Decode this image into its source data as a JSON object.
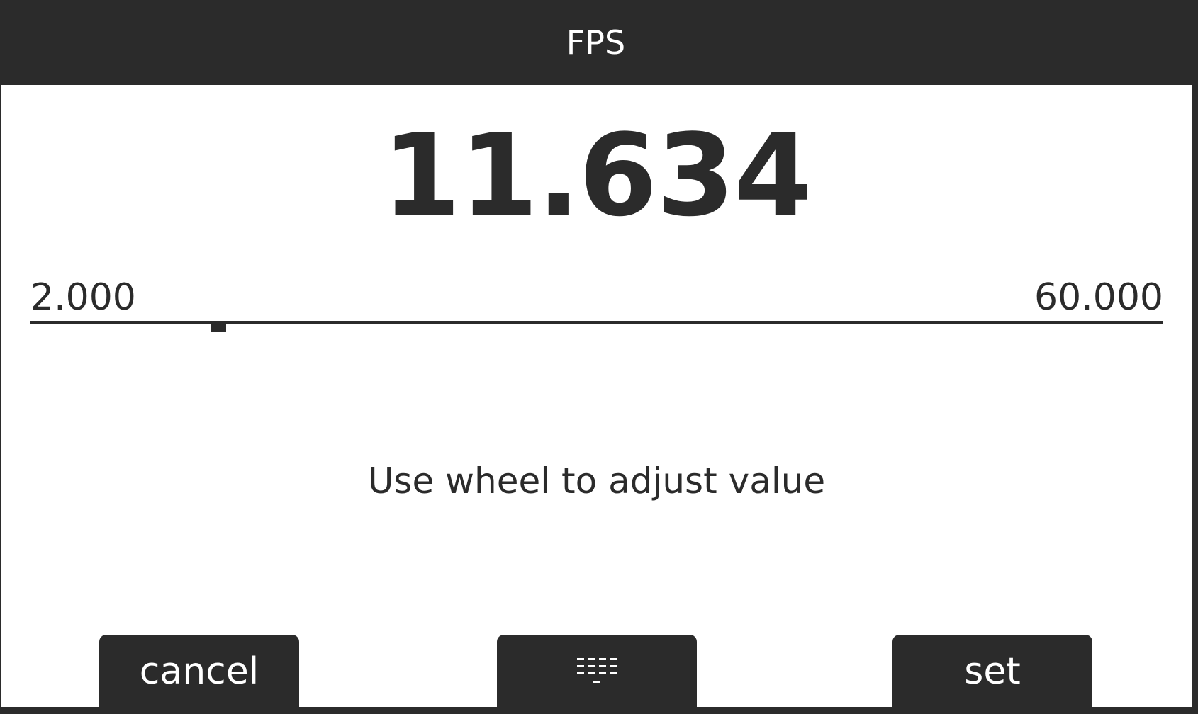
{
  "header": {
    "title": "FPS"
  },
  "value": {
    "current": "11.634",
    "min_label": "2.000",
    "max_label": "60.000",
    "slider_fraction": 0.166
  },
  "hint": "Use wheel to adjust value",
  "buttons": {
    "cancel_label": "cancel",
    "keypad_icon": "keypad-icon",
    "set_label": "set"
  },
  "colors": {
    "dark": "#2b2b2b",
    "background": "#ffffff"
  }
}
